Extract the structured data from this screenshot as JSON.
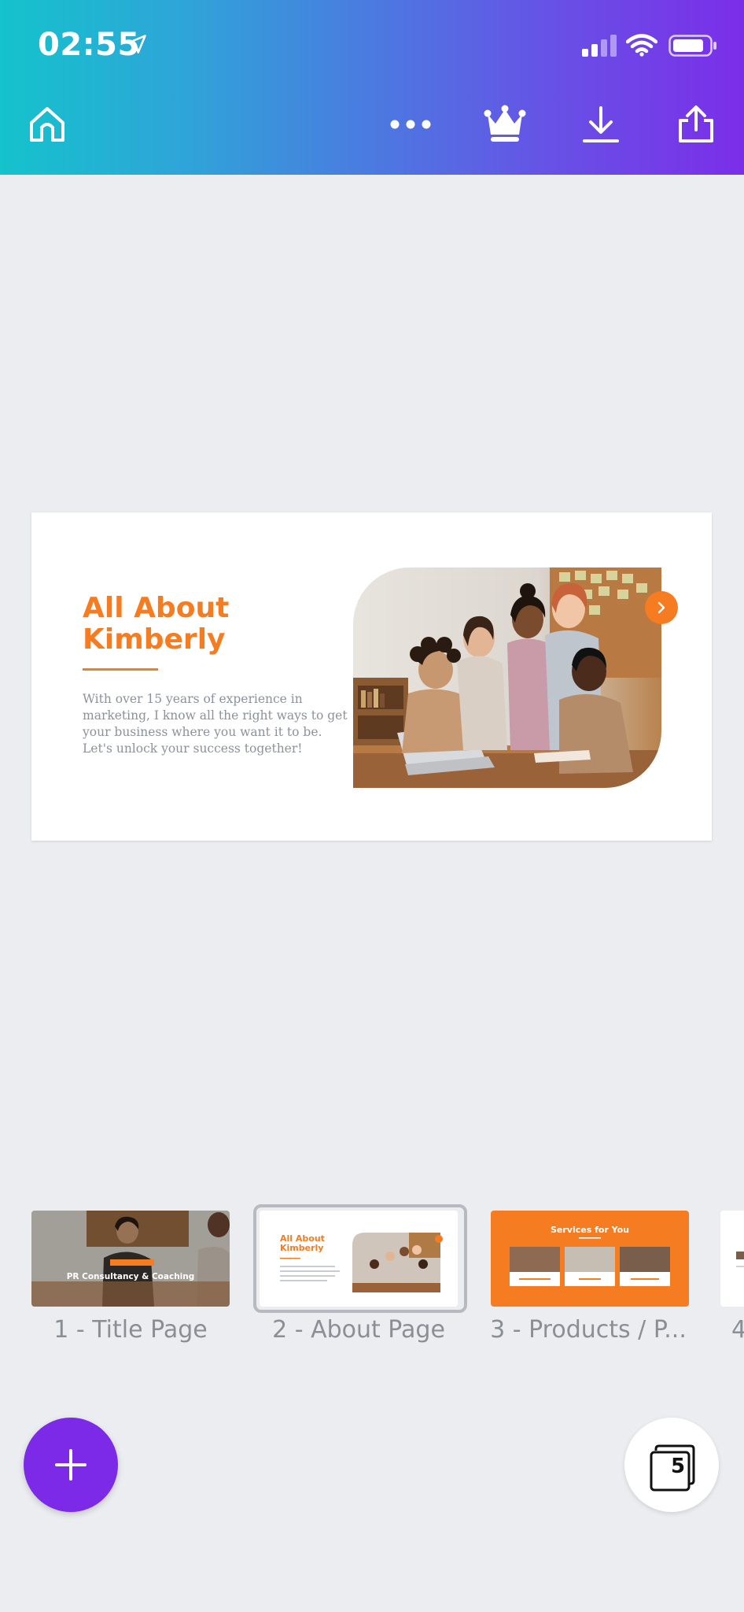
{
  "status_bar": {
    "time": "02:55"
  },
  "toolbar": {
    "home_icon": "home-icon",
    "more_icon": "more-icon",
    "premium_icon": "crown-icon",
    "download_icon": "download-icon",
    "share_icon": "share-icon"
  },
  "slide": {
    "title_line1": "All About",
    "title_line2": "Kimberly",
    "body_lines": [
      "With over 15 years of experience in",
      "marketing, I know all the right ways to get",
      "your business where you want it to be.",
      "Let's unlock your success together!"
    ],
    "accent_color": "#f57c20"
  },
  "pages": [
    {
      "label": "1 - Title Page",
      "thumb_text": "PR Consultancy & Coaching"
    },
    {
      "label": "2 - About Page",
      "thumb_text": "All About Kimberly"
    },
    {
      "label": "3 - Products / P...",
      "thumb_text": "Services for You"
    },
    {
      "label": "4"
    }
  ],
  "page_count": "5",
  "colors": {
    "header_start": "#14c3cc",
    "header_end": "#7b2ee8",
    "fab": "#7d2ae8",
    "background": "#ebedf0"
  }
}
